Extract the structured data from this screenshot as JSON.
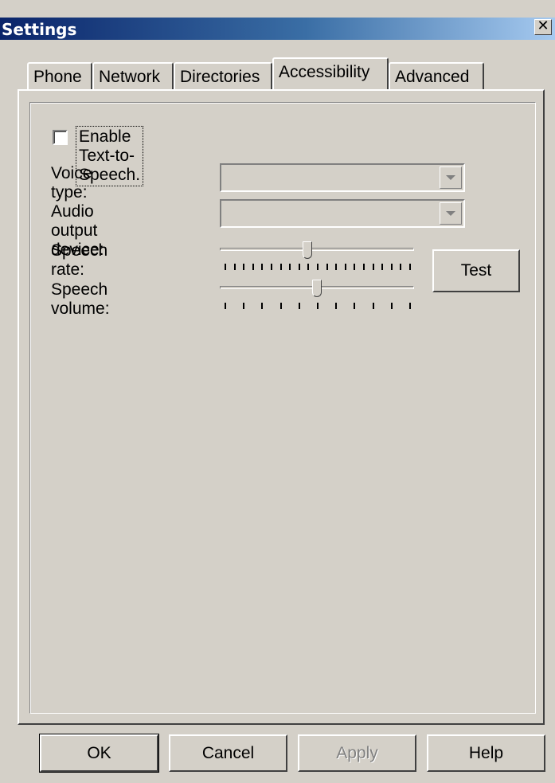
{
  "window": {
    "title": "Settings",
    "close_glyph": "✕"
  },
  "tabs": [
    {
      "label": "Phone",
      "active": false
    },
    {
      "label": "Network",
      "active": false
    },
    {
      "label": "Directories",
      "active": false
    },
    {
      "label": "Accessibility",
      "active": true
    },
    {
      "label": "Advanced",
      "active": false
    }
  ],
  "accessibility": {
    "enable_tts": {
      "label": "Enable Text-to-Speech",
      "checked": false
    },
    "voice_type": {
      "label": "Voice type:",
      "value": "",
      "enabled": false
    },
    "audio_output_device": {
      "label": "Audio output device:",
      "value": "",
      "enabled": false
    },
    "speech_rate": {
      "label": "Speech rate:",
      "level": 0.45,
      "tick_count": 21
    },
    "speech_volume": {
      "label": "Speech volume:",
      "level": 0.5,
      "tick_count": 11
    },
    "test_button": "Test"
  },
  "footer": {
    "ok": "OK",
    "cancel": "Cancel",
    "apply": {
      "label": "Apply",
      "enabled": false
    },
    "help": "Help"
  },
  "icons": {
    "close": "close-icon",
    "dropdown": "chevron-down-icon"
  },
  "colors": {
    "title_start": "#0a246a",
    "title_end": "#a6caf0",
    "face": "#d4d0c8"
  }
}
